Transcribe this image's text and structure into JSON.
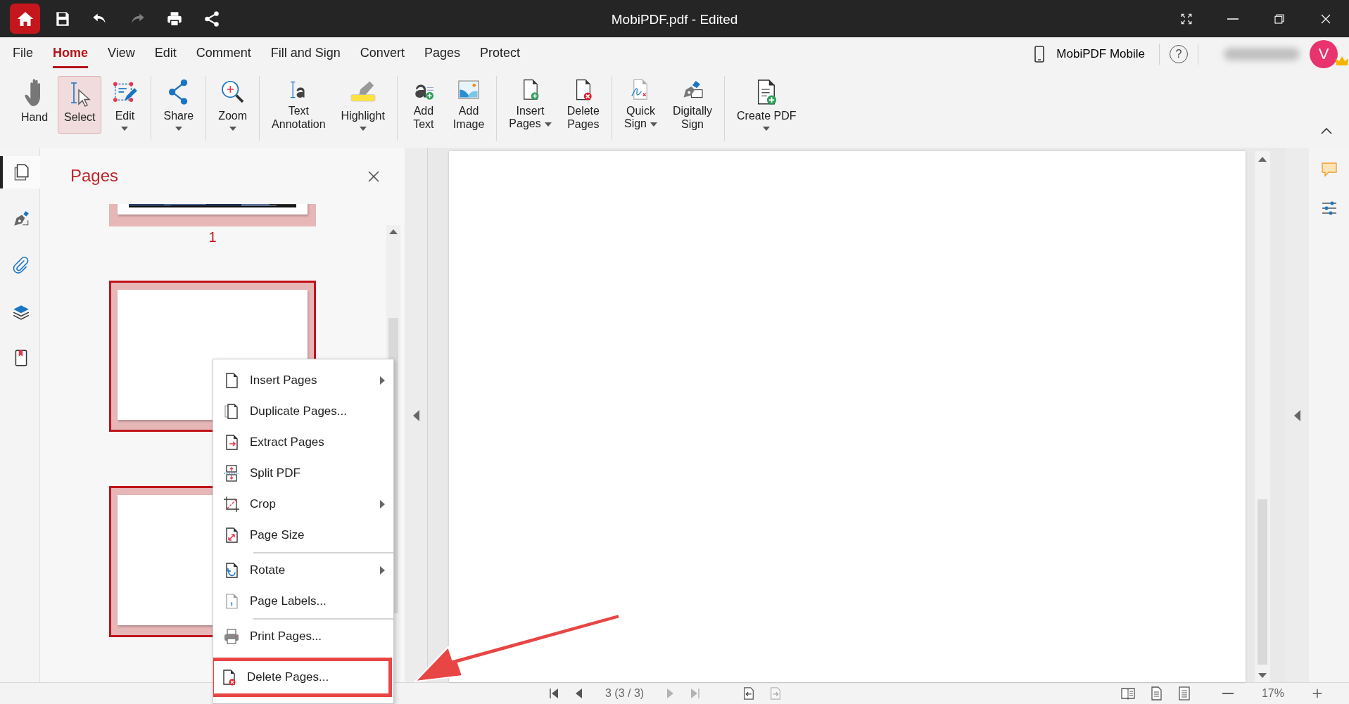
{
  "window": {
    "title": "MobiPDF.pdf - Edited"
  },
  "quick_access": [
    {
      "disabled": false
    },
    {
      "disabled": false
    },
    {
      "disabled": false
    },
    {
      "disabled": true
    },
    {
      "disabled": false
    },
    {
      "disabled": false
    }
  ],
  "menu_tabs": [
    {
      "label": "File",
      "selected": false
    },
    {
      "label": "Home",
      "selected": true
    },
    {
      "label": "View",
      "selected": false
    },
    {
      "label": "Edit",
      "selected": false
    },
    {
      "label": "Comment",
      "selected": false
    },
    {
      "label": "Fill and Sign",
      "selected": false
    },
    {
      "label": "Convert",
      "selected": false
    },
    {
      "label": "Pages",
      "selected": false
    },
    {
      "label": "Protect",
      "selected": false
    }
  ],
  "account": {
    "mobile_link": "MobiPDF Mobile",
    "help": "?",
    "avatar": "V"
  },
  "ribbon": {
    "groups": [
      {
        "buttons": [
          {
            "label": "Hand",
            "selected": false,
            "dropdown": false
          },
          {
            "label": "Select",
            "selected": true,
            "dropdown": false
          },
          {
            "label": "Edit",
            "selected": false,
            "dropdown": true
          }
        ]
      },
      {
        "buttons": [
          {
            "label": "Share",
            "selected": false,
            "dropdown": true
          }
        ]
      },
      {
        "buttons": [
          {
            "label": "Zoom",
            "selected": false,
            "dropdown": true
          }
        ]
      },
      {
        "buttons": [
          {
            "label": "Text\nAnnotation",
            "selected": false,
            "dropdown": false
          },
          {
            "label": "Highlight",
            "selected": false,
            "dropdown": true
          }
        ]
      },
      {
        "buttons": [
          {
            "label": "Add\nText",
            "selected": false,
            "dropdown": false
          },
          {
            "label": "Add\nImage",
            "selected": false,
            "dropdown": false
          }
        ]
      },
      {
        "buttons": [
          {
            "label": "Insert\nPages",
            "selected": false,
            "dropdown": true
          },
          {
            "label": "Delete\nPages",
            "selected": false,
            "dropdown": false
          }
        ]
      },
      {
        "buttons": [
          {
            "label": "Quick\nSign",
            "selected": false,
            "dropdown": true
          },
          {
            "label": "Digitally\nSign",
            "selected": false,
            "dropdown": false
          }
        ]
      },
      {
        "buttons": [
          {
            "label": "Create PDF",
            "selected": false,
            "dropdown": true
          }
        ]
      }
    ]
  },
  "side_rail": [
    {
      "selected": true
    },
    {
      "selected": false
    },
    {
      "selected": false
    },
    {
      "selected": false
    },
    {
      "selected": false
    }
  ],
  "pages_panel": {
    "title": "Pages",
    "thumbnails": [
      {
        "label": "1",
        "selected": true,
        "focused": false,
        "kind": "picture"
      },
      {
        "selected": true,
        "focused": true,
        "kind": "blank"
      },
      {
        "selected": true,
        "focused": true,
        "kind": "blank"
      }
    ]
  },
  "context_menu": {
    "items": [
      {
        "label": "Insert Pages",
        "submenu": true,
        "divider_above": false,
        "highlighted": false
      },
      {
        "label": "Duplicate Pages...",
        "submenu": false,
        "divider_above": false,
        "highlighted": false
      },
      {
        "label": "Extract Pages",
        "submenu": false,
        "divider_above": false,
        "highlighted": false
      },
      {
        "label": "Split PDF",
        "submenu": false,
        "divider_above": false,
        "highlighted": false
      },
      {
        "label": "Crop",
        "submenu": true,
        "divider_above": false,
        "highlighted": false
      },
      {
        "label": "Page Size",
        "submenu": false,
        "divider_above": false,
        "highlighted": false
      },
      {
        "label": "Rotate",
        "submenu": true,
        "divider_above": true,
        "highlighted": false
      },
      {
        "label": "Page Labels...",
        "submenu": false,
        "divider_above": false,
        "highlighted": false
      },
      {
        "label": "Print Pages...",
        "submenu": false,
        "divider_above": true,
        "highlighted": false
      },
      {
        "label": "Delete Pages...",
        "submenu": false,
        "divider_above": false,
        "highlighted": true
      }
    ]
  },
  "annotation_arrow": true,
  "status_bar": {
    "nav": [
      {
        "disabled": false
      },
      {
        "disabled": false
      },
      {
        "disabled": true
      },
      {
        "disabled": true
      }
    ],
    "page_indicator": "3 (3 / 3)",
    "history": [
      {
        "disabled": false
      },
      {
        "disabled": true
      }
    ],
    "zoom": "17%"
  }
}
